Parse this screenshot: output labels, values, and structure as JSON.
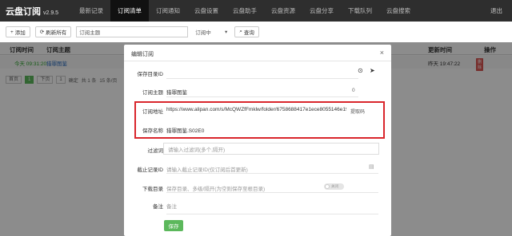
{
  "navbar": {
    "brand": "云盘订阅",
    "version": "v2.9.5",
    "items": [
      "最新记录",
      "订阅清单",
      "订阅通知",
      "云盘设置",
      "云盘助手",
      "云盘资源",
      "云盘分享",
      "下载队列",
      "云盘搜索"
    ],
    "active_index": 1,
    "exit": "退出"
  },
  "toolbar": {
    "add_label": "添加",
    "refresh_all_label": "刷新所有",
    "topic_label": "订阅主题",
    "status_select": "订阅中",
    "query_label": "查询"
  },
  "table": {
    "headers": {
      "time": "订阅时间",
      "topic": "订阅主题",
      "update": "更新时间",
      "ops": "操作"
    },
    "row": {
      "time": "今天 09:31:20",
      "topic": "猎罪图鉴",
      "update": "昨天 19:47:22",
      "op_edit": "编辑",
      "op_delete": "删除"
    }
  },
  "pager": {
    "current": "1",
    "first": "首页",
    "prev": "上页",
    "next": "下页",
    "last": "尾页",
    "goto": "1",
    "confirm": "确定",
    "total_count": "共 1 条",
    "per_page": "15 条/页"
  },
  "modal": {
    "title": "编辑订阅",
    "close": "×",
    "fields": {
      "save_dir_id": {
        "label": "保存目录ID",
        "value": ""
      },
      "topic": {
        "label": "订阅主题",
        "value": "猎罪图鉴",
        "count": "0"
      },
      "address": {
        "label": "订阅地址",
        "value": "https://www.alipan.com/s/McQWZfFmklw/folder/6758688417e1ece8055146e190",
        "action": "提取码"
      },
      "save_name": {
        "label": "保存名称",
        "value": "猎罪图鉴.S02E0"
      },
      "filter": {
        "label": "过滤词",
        "placeholder": "请输入过滤词(多个,隔开)"
      },
      "stop_id": {
        "label": "截止记录ID",
        "placeholder": "请输入截止记录ID(仅订阅后首更新)"
      },
      "download_dir": {
        "label": "下载目录",
        "placeholder": "保存目录、多级/隔开(为空则保存至根目录)",
        "toggle": "关闭"
      },
      "note": {
        "label": "备注",
        "placeholder": "备注"
      }
    },
    "save_label": "保存"
  }
}
